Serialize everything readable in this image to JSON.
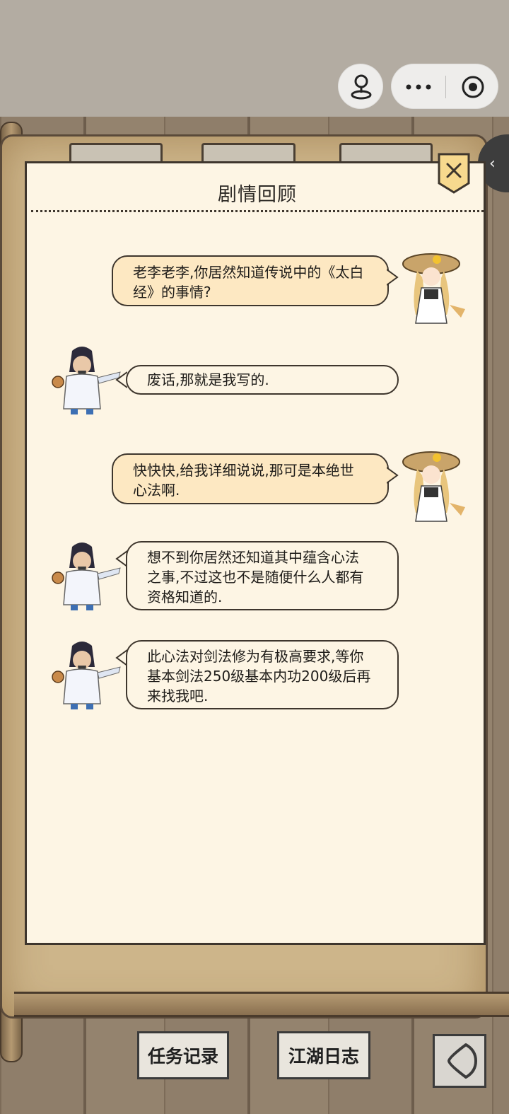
{
  "header": {
    "capsule_icons": [
      "pin-icon",
      "more-dots-icon",
      "target-icon"
    ]
  },
  "panel": {
    "title": "剧情回顾",
    "close_icon": "close-icon"
  },
  "messages": [
    {
      "speaker": "girl",
      "side": "right",
      "lines": [
        "老李老李,你居然知道传说中的《太白",
        "经》的事情?"
      ]
    },
    {
      "speaker": "swordsman",
      "side": "left",
      "lines": [
        "废话,那就是我写的."
      ]
    },
    {
      "speaker": "girl",
      "side": "right",
      "lines": [
        "快快快,给我详细说说,那可是本绝世",
        "心法啊."
      ]
    },
    {
      "speaker": "swordsman",
      "side": "left",
      "lines": [
        "想不到你居然还知道其中蕴含心法",
        "之事,不过这也不是随便什么人都有",
        "资格知道的."
      ]
    },
    {
      "speaker": "swordsman",
      "side": "left",
      "lines": [
        "此心法对剑法修为有极高要求,等你",
        "基本剑法250级基本内功200级后再",
        "来找我吧."
      ]
    }
  ],
  "side_toggle": {
    "label": "‹"
  },
  "footer": {
    "task_log_label": "任务记录",
    "jianghu_log_label": "江湖日志",
    "back_icon": "back-arrow-icon"
  },
  "colors": {
    "panel_bg": "#fdf5e4",
    "bubble_right_bg": "#fde8c2",
    "border": "#3e362d"
  }
}
